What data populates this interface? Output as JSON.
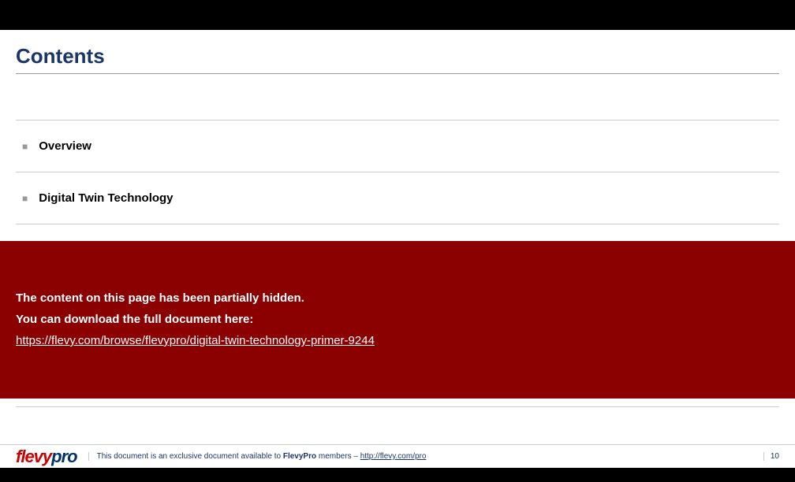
{
  "title": "Contents",
  "toc": {
    "items": [
      {
        "label": "Overview"
      },
      {
        "label": "Digital Twin Technology"
      }
    ]
  },
  "hidden_panel": {
    "line1": "The content on this page has been partially hidden.",
    "line2": "You can download the full document here:",
    "link_text": "https://flevy.com/browse/flevypro/digital-twin-technology-primer-9244"
  },
  "footer": {
    "logo_part1": "flevy",
    "logo_part2": "pro",
    "text_before": "This document is an exclusive document available to ",
    "text_bold": "FlevyPro",
    "text_after": " members – ",
    "link": "http://flevy.com/pro",
    "page": "10"
  }
}
